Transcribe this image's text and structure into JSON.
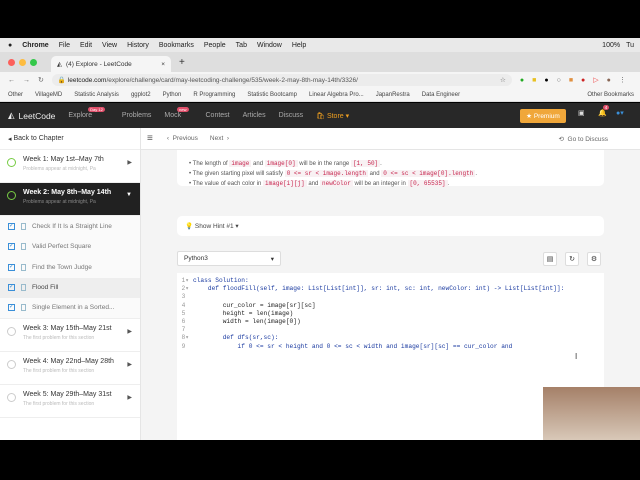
{
  "menubar": {
    "items": [
      "Chrome",
      "File",
      "Edit",
      "View",
      "History",
      "Bookmarks",
      "People",
      "Tab",
      "Window",
      "Help"
    ],
    "battery": "100%",
    "time": "Tu"
  },
  "tab": {
    "title": "(4) Explore - LeetCode"
  },
  "address": {
    "domain": "leetcode.com",
    "path": "/explore/challenge/card/may-leetcoding-challenge/535/week-2-may-8th-may-14th/3326/"
  },
  "bookmarks": [
    "Other",
    "VillageMD",
    "Statistic Analysis",
    "ggplot2",
    "Python",
    "R Programming",
    "Statistic Bootcamp",
    "Linear Algebra Pro...",
    "JapanRestra",
    "Data Engineer"
  ],
  "other_bookmarks": "Other Bookmarks",
  "nav": {
    "logo": "LeetCode",
    "items": [
      "Explore",
      "Problems",
      "Mock",
      "Contest",
      "Articles",
      "Discuss"
    ],
    "explore_badge": "Day 12",
    "mock_badge": "new",
    "store": "Store",
    "premium": "Premium",
    "notif_count": "4"
  },
  "sidebar": {
    "back": "Back to Chapter",
    "weeks_top": [
      {
        "title": "Week 1: May 1st–May 7th",
        "sub": "Problems appear at midnight, Pa"
      },
      {
        "title": "Week 2: May 8th–May 14th",
        "sub": "Problems appear at midnight, Pa"
      }
    ],
    "problems": [
      "Check If It Is a Straight Line",
      "Valid Perfect Square",
      "Find the Town Judge",
      "Flood Fill",
      "Single Element in a Sorted..."
    ],
    "weeks_bottom": [
      {
        "title": "Week 3: May 15th–May 21st",
        "sub": "The first problem for this section"
      },
      {
        "title": "Week 4: May 22nd–May 28th",
        "sub": "The first problem for this section"
      },
      {
        "title": "Week 5: May 29th–May 31st",
        "sub": "The first problem for this section"
      }
    ]
  },
  "pager": {
    "previous": "Previous",
    "next": "Next",
    "go_discuss": "Go to Discuss"
  },
  "notes": [
    {
      "a": "The length of ",
      "c1": "image",
      "b": " and ",
      "c2": "image[0]",
      "d": " will be in the range ",
      "c3": "[1, 50]",
      "e": "."
    },
    {
      "a": "The given starting pixel will satisfy ",
      "c1": "0 <= sr < image.length",
      "b": " and ",
      "c2": "0 <= sc < image[0].length",
      "d": "",
      "c3": "",
      "e": "."
    },
    {
      "a": "The value of each color in ",
      "c1": "image[i][j]",
      "b": " and ",
      "c2": "newColor",
      "d": " will be an integer in ",
      "c3": "[0, 65535]",
      "e": "."
    }
  ],
  "hint": "Show Hint #1",
  "language": "Python3",
  "code": [
    "class Solution:",
    "    def floodFill(self, image: List[List[int]], sr: int, sc: int, newColor: int) -> List[List[int]]:",
    "",
    "        cur_color = image[sr][sc]",
    "        height = len(image)",
    "        width = len(image[0])",
    "",
    "        def dfs(sr,sc):",
    "            if 0 <= sr < height and 0 <= sc < width and image[sr][sc] == cur_color and"
  ]
}
